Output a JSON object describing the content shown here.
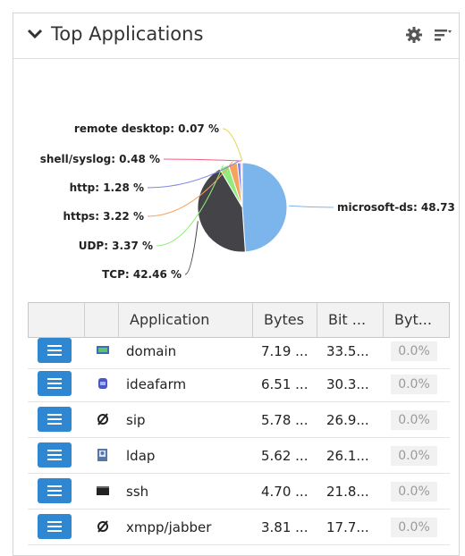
{
  "widget": {
    "title": "Top Applications",
    "icons": {
      "collapse": "chevron-down-icon",
      "settings": "gear-icon",
      "menu": "menu-icon"
    }
  },
  "chart_data": {
    "type": "pie",
    "slices": [
      {
        "label": "microsoft-ds: 48.73",
        "value": 48.73,
        "color": "#7cb5ec"
      },
      {
        "label": "TCP: 42.46 %",
        "value": 42.46,
        "color": "#434348"
      },
      {
        "label": "UDP: 3.37 %",
        "value": 3.37,
        "color": "#90ed7d"
      },
      {
        "label": "https: 3.22 %",
        "value": 3.22,
        "color": "#f7a35c"
      },
      {
        "label": "http: 1.28 %",
        "value": 1.28,
        "color": "#8085e9"
      },
      {
        "label": "shell/syslog: 0.48 %",
        "value": 0.48,
        "color": "#f15c80"
      },
      {
        "label": "remote desktop: 0.07 %",
        "value": 0.07,
        "color": "#e4d354"
      }
    ]
  },
  "table": {
    "columns": [
      "Application",
      "Bytes",
      "Bit ...",
      "Byt..."
    ],
    "rows": [
      {
        "app": "domain",
        "icon": "network-icon",
        "bytes": "7.19 ...",
        "bit": "33.5...",
        "pct": "0.0%"
      },
      {
        "app": "ideafarm",
        "icon": "database-icon",
        "bytes": "6.51 ...",
        "bit": "30.3...",
        "pct": "0.0%"
      },
      {
        "app": "sip",
        "icon": "no-icon",
        "bytes": "5.78 ...",
        "bit": "26.9...",
        "pct": "0.0%"
      },
      {
        "app": "ldap",
        "icon": "directory-icon",
        "bytes": "5.62 ...",
        "bit": "26.1...",
        "pct": "0.0%"
      },
      {
        "app": "ssh",
        "icon": "terminal-icon",
        "bytes": "4.70 ...",
        "bit": "21.8...",
        "pct": "0.0%"
      },
      {
        "app": "xmpp/jabber",
        "icon": "no-icon",
        "bytes": "3.81 ...",
        "bit": "17.7...",
        "pct": "0.0%"
      }
    ]
  }
}
